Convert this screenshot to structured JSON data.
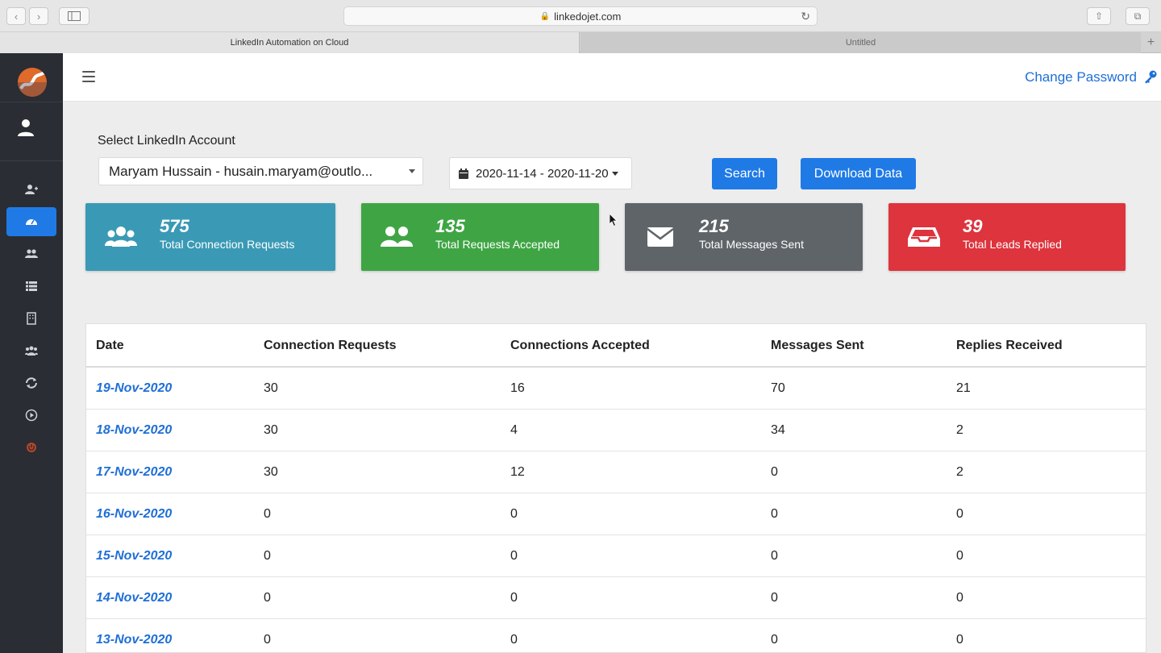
{
  "browser": {
    "url": "linkedojet.com",
    "tabs": [
      "LinkedIn Automation on Cloud",
      "Untitled"
    ]
  },
  "header": {
    "change_password": "Change Password"
  },
  "filters": {
    "label": "Select LinkedIn Account",
    "account": "Maryam Hussain - husain.maryam@outlo...",
    "date_range": "2020-11-14 - 2020-11-20",
    "search_label": "Search",
    "download_label": "Download Data"
  },
  "stats": [
    {
      "value": "575",
      "label": "Total Connection Requests",
      "color": "#3a9ab5",
      "icon": "users-icon"
    },
    {
      "value": "135",
      "label": "Total Requests Accepted",
      "color": "#3fa544",
      "icon": "user-friends-icon"
    },
    {
      "value": "215",
      "label": "Total Messages Sent",
      "color": "#5f6468",
      "icon": "envelope-icon"
    },
    {
      "value": "39",
      "label": "Total Leads Replied",
      "color": "#dd343d",
      "icon": "inbox-icon"
    }
  ],
  "table": {
    "headers": [
      "Date",
      "Connection Requests",
      "Connections Accepted",
      "Messages Sent",
      "Replies Received"
    ],
    "rows": [
      {
        "date": "19-Nov-2020",
        "requests": "30",
        "accepted": "16",
        "messages": "70",
        "replies": "21"
      },
      {
        "date": "18-Nov-2020",
        "requests": "30",
        "accepted": "4",
        "messages": "34",
        "replies": "2"
      },
      {
        "date": "17-Nov-2020",
        "requests": "30",
        "accepted": "12",
        "messages": "0",
        "replies": "2"
      },
      {
        "date": "16-Nov-2020",
        "requests": "0",
        "accepted": "0",
        "messages": "0",
        "replies": "0"
      },
      {
        "date": "15-Nov-2020",
        "requests": "0",
        "accepted": "0",
        "messages": "0",
        "replies": "0"
      },
      {
        "date": "14-Nov-2020",
        "requests": "0",
        "accepted": "0",
        "messages": "0",
        "replies": "0"
      },
      {
        "date": "13-Nov-2020",
        "requests": "0",
        "accepted": "0",
        "messages": "0",
        "replies": "0"
      }
    ]
  },
  "colors": {
    "sidebar": "#2a2d33",
    "accent": "#1f7ae6",
    "link": "#1f6fd6"
  }
}
